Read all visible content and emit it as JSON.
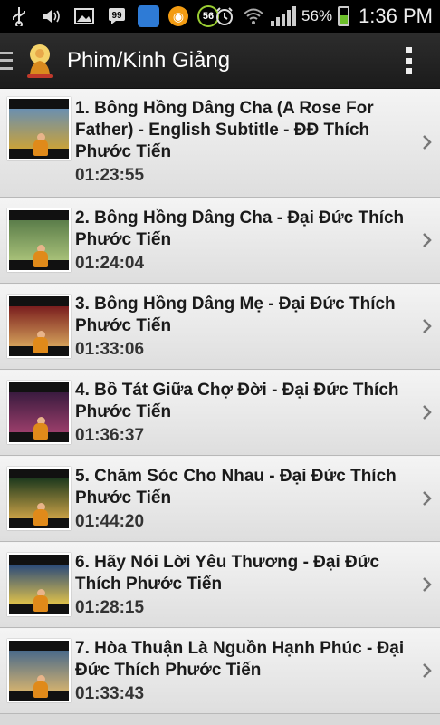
{
  "status_bar": {
    "battery_percent": "56%",
    "time": "1:36 PM",
    "notification_badge": "56",
    "battery_level": 0.56,
    "icons": [
      "usb-icon",
      "volume-icon",
      "image-icon",
      "chat-icon",
      "app-icon",
      "app2-icon",
      "badge-icon",
      "alarm-icon",
      "wifi-icon",
      "signal-icon",
      "battery-icon"
    ]
  },
  "action_bar": {
    "title": "Phim/Kinh Giảng"
  },
  "videos": [
    {
      "title": "1. Bông Hồng Dâng Cha (A Rose For Father) - English Subtitle - ĐĐ Thích Phước Tiến",
      "duration": "01:23:55"
    },
    {
      "title": "2. Bông Hồng Dâng Cha - Đại Đức Thích Phước Tiến",
      "duration": "01:24:04"
    },
    {
      "title": "3. Bông Hồng Dâng Mẹ - Đại Đức Thích Phước Tiến",
      "duration": "01:33:06"
    },
    {
      "title": "4. Bồ Tát Giữa Chợ Đời - Đại Đức Thích Phước Tiến",
      "duration": "01:36:37"
    },
    {
      "title": "5. Chăm Sóc Cho Nhau - Đại Đức Thích Phước Tiến",
      "duration": "01:44:20"
    },
    {
      "title": "6. Hãy Nói Lời Yêu Thương - Đại Đức Thích Phước Tiến",
      "duration": "01:28:15"
    },
    {
      "title": "7. Hòa Thuận Là Nguồn Hạnh Phúc - Đại Đức Thích Phước Tiến",
      "duration": "01:33:43"
    }
  ]
}
